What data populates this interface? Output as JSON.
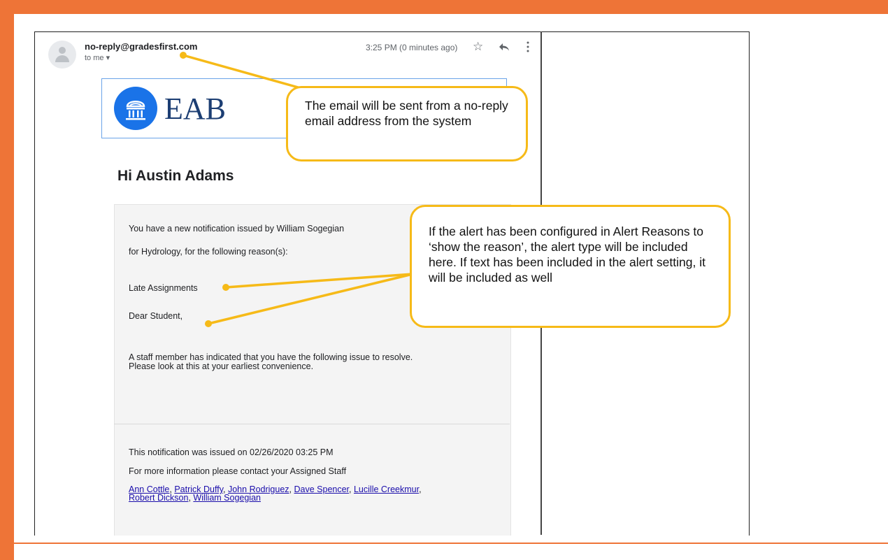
{
  "email": {
    "sender": "no-reply@gradesfirst.com",
    "recipient": "to me ▾",
    "timestamp": "3:25 PM (0 minutes ago)",
    "icons": {
      "star": "star-icon",
      "reply": "reply-icon",
      "more": "more-vert-icon",
      "avatar": "person-avatar-icon"
    }
  },
  "logo": {
    "text": "EAB",
    "icon": "institution-columns-icon",
    "brand_color": "#1a73e8"
  },
  "body": {
    "greeting": "Hi Austin Adams",
    "line1": "You have a new notification issued by William Sogegian",
    "line2": "for Hydrology, for the following reason(s):",
    "reason": "Late Assignments",
    "salutation": "Dear Student,",
    "message_line1": "A staff member has indicated that you have the following issue to resolve.",
    "message_line2": "Please look at this at your earliest convenience.",
    "issued_on": "This notification was issued on 02/26/2020 03:25 PM",
    "contact": "For more information please contact your Assigned Staff",
    "staff": [
      "Ann Cottle",
      "Patrick Duffy",
      "John Rodriguez",
      "Dave Spencer",
      "Lucille Creekmur",
      "Robert Dickson",
      "William Sogegian"
    ]
  },
  "callouts": {
    "sender_note": "The email will be sent from a no-reply email address from the system",
    "reason_note": "If the alert has been configured in Alert Reasons to ‘show the reason’, the alert type will be included here. If text has been included in the alert setting, it will be included as well"
  },
  "colors": {
    "frame": "#ee7437",
    "callout_border": "#f6ba18",
    "link": "#1a0dab"
  }
}
